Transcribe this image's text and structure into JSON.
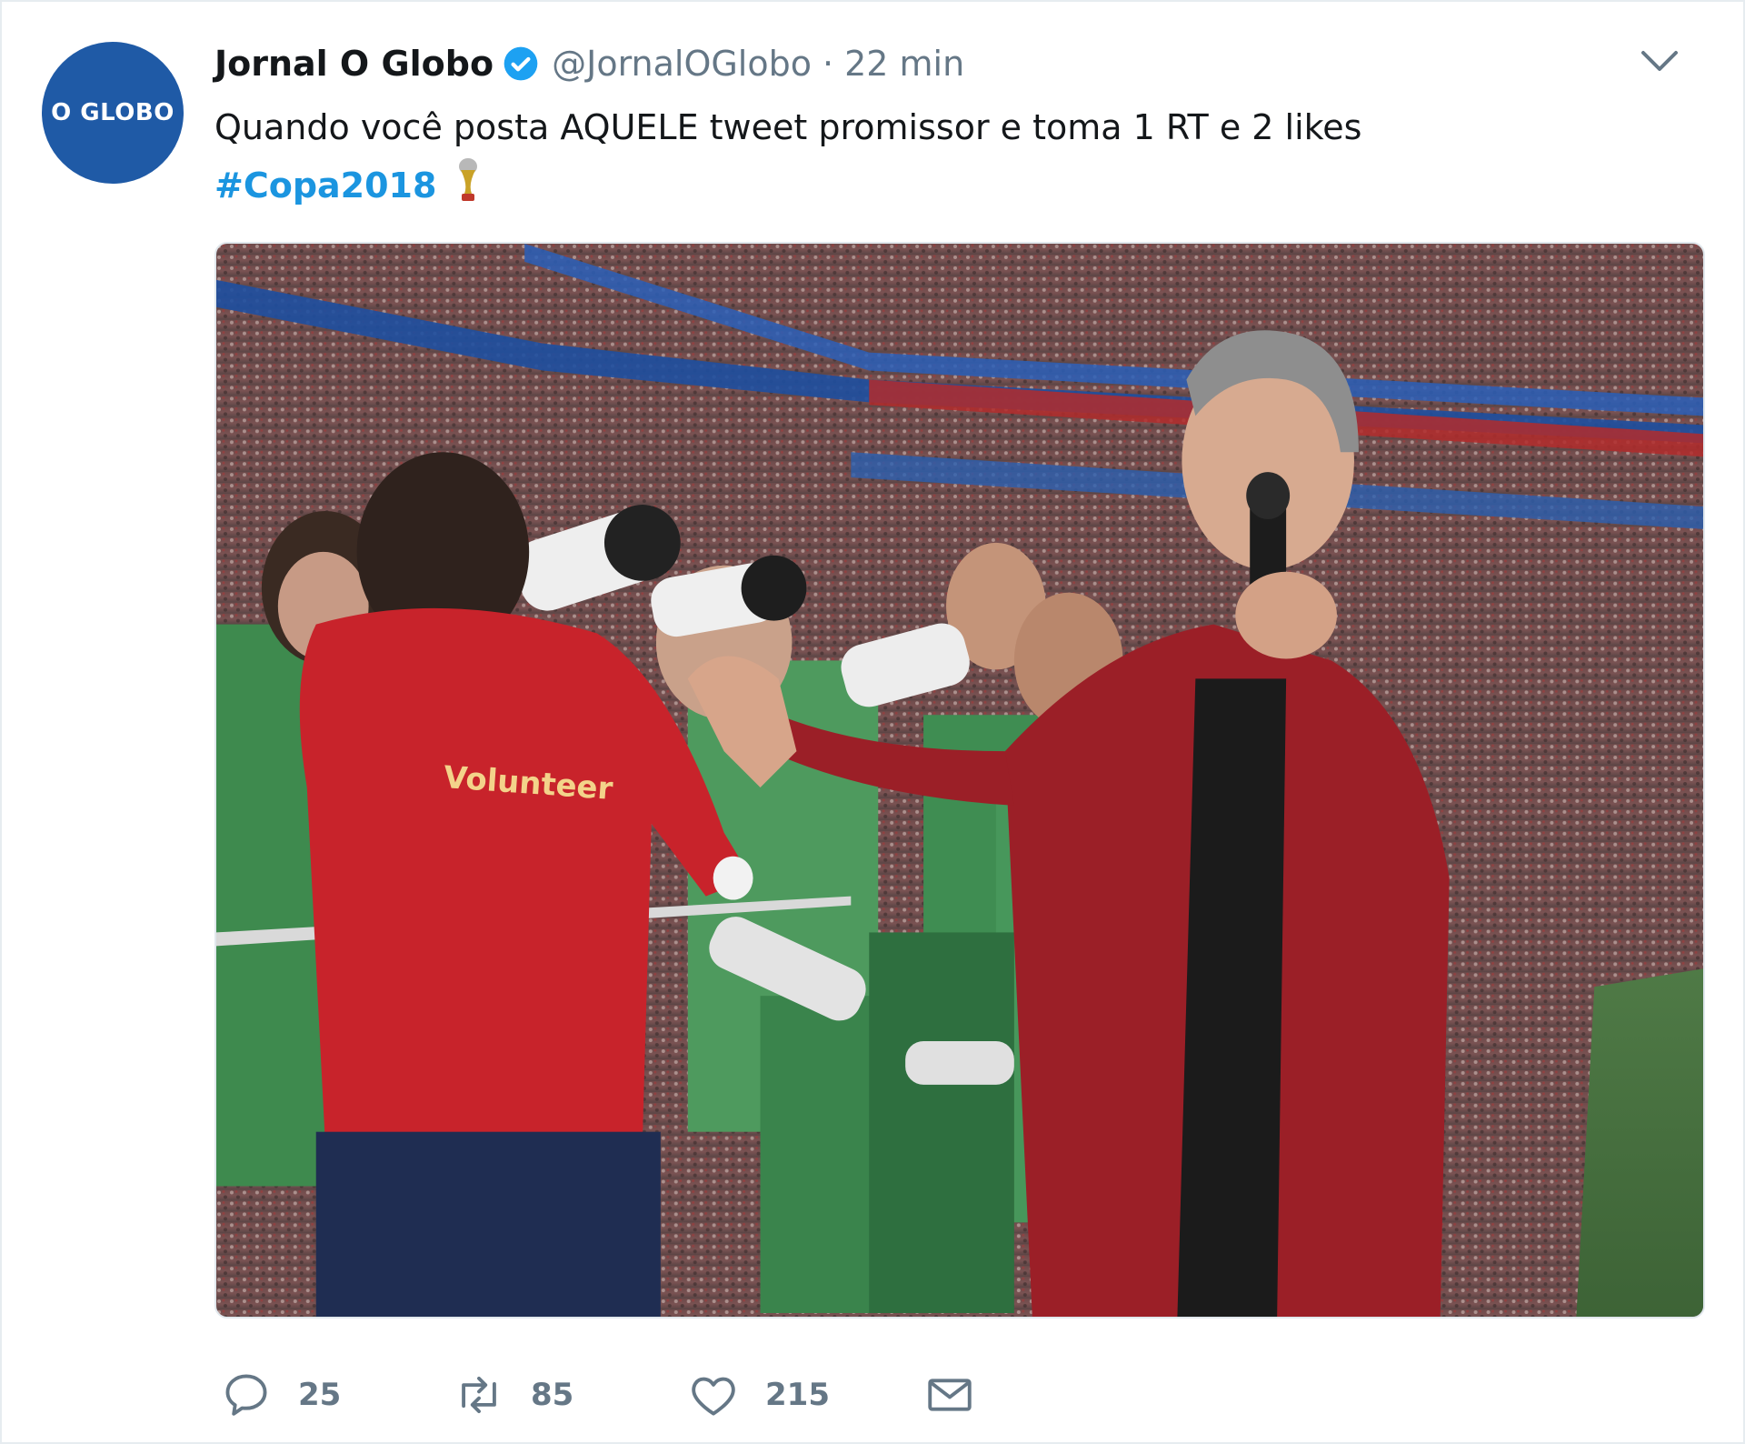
{
  "tweet": {
    "avatar_text": "O GLOBO",
    "display_name": "Jornal O Globo",
    "handle": "@JornalOGlobo",
    "separator": "·",
    "time": "22 min",
    "text": "Quando você posta AQUELE tweet promissor e toma 1 RT e 2 likes",
    "hashtag": "#Copa2018",
    "icons": {
      "verified": "verified-badge-icon",
      "caret": "chevron-down-icon",
      "trophy": "trophy-icon"
    },
    "media": {
      "image_text": "Volunteer"
    },
    "actions": {
      "reply_count": "25",
      "retweet_count": "85",
      "like_count": "215"
    }
  },
  "colors": {
    "text": "#14171a",
    "secondary": "#657786",
    "link": "#1b95e0",
    "avatar_bg": "#1f5aa6",
    "verified": "#1da1f2"
  }
}
